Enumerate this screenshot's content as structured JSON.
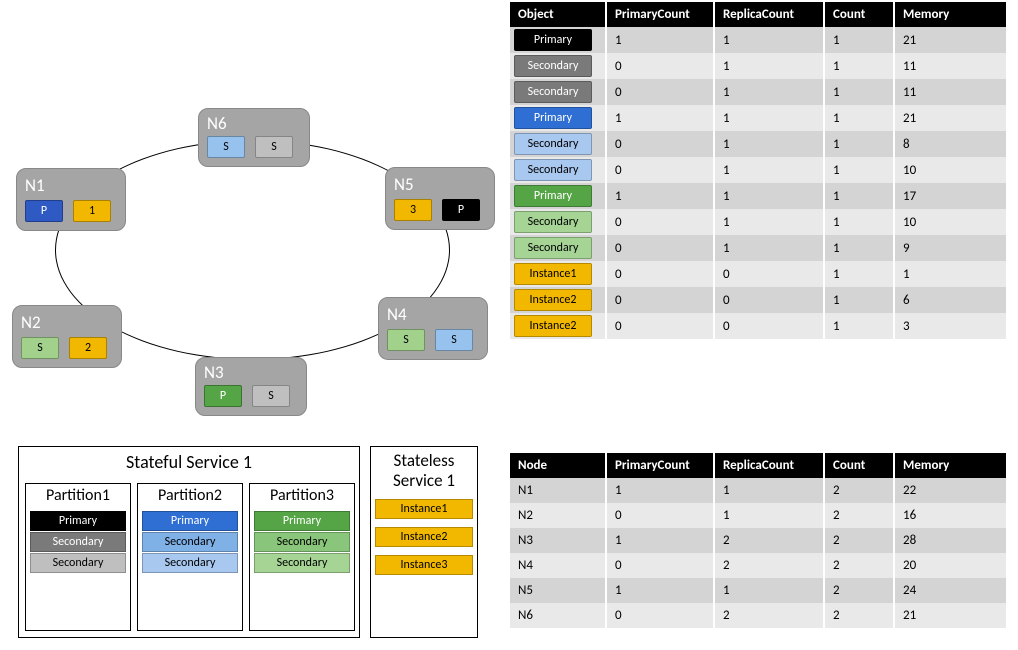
{
  "ring": {
    "nodes": {
      "N1": {
        "label": "N1",
        "chips": [
          {
            "txt": "P",
            "cls": "blue-d"
          },
          {
            "txt": "1",
            "cls": "orange"
          }
        ]
      },
      "N2": {
        "label": "N2",
        "chips": [
          {
            "txt": "S",
            "cls": "green-l"
          },
          {
            "txt": "2",
            "cls": "orange"
          }
        ]
      },
      "N3": {
        "label": "N3",
        "chips": [
          {
            "txt": "P",
            "cls": "green-d"
          },
          {
            "txt": "S",
            "cls": "gray-l"
          }
        ]
      },
      "N4": {
        "label": "N4",
        "chips": [
          {
            "txt": "S",
            "cls": "green-l"
          },
          {
            "txt": "S",
            "cls": "blue-l"
          }
        ]
      },
      "N5": {
        "label": "N5",
        "chips": [
          {
            "txt": "3",
            "cls": "orange"
          },
          {
            "txt": "P",
            "cls": "black"
          }
        ]
      },
      "N6": {
        "label": "N6",
        "chips": [
          {
            "txt": "S",
            "cls": "blue-l"
          },
          {
            "txt": "S",
            "cls": "gray-l"
          }
        ]
      }
    }
  },
  "table1": {
    "headers": [
      "Object",
      "PrimaryCount",
      "ReplicaCount",
      "Count",
      "Memory"
    ],
    "rows": [
      {
        "obj": {
          "txt": "Primary",
          "cls": "black"
        },
        "pc": "1",
        "rc": "1",
        "c": "1",
        "m": "21"
      },
      {
        "obj": {
          "txt": "Secondary",
          "cls": "gray-d"
        },
        "pc": "0",
        "rc": "1",
        "c": "1",
        "m": "11"
      },
      {
        "obj": {
          "txt": "Secondary",
          "cls": "gray-d"
        },
        "pc": "0",
        "rc": "1",
        "c": "1",
        "m": "11"
      },
      {
        "obj": {
          "txt": "Primary",
          "cls": "blue-d"
        },
        "pc": "1",
        "rc": "1",
        "c": "1",
        "m": "21"
      },
      {
        "obj": {
          "txt": "Secondary",
          "cls": "blue-l"
        },
        "pc": "0",
        "rc": "1",
        "c": "1",
        "m": "8"
      },
      {
        "obj": {
          "txt": "Secondary",
          "cls": "blue-l"
        },
        "pc": "0",
        "rc": "1",
        "c": "1",
        "m": "10"
      },
      {
        "obj": {
          "txt": "Primary",
          "cls": "green-d"
        },
        "pc": "1",
        "rc": "1",
        "c": "1",
        "m": "17"
      },
      {
        "obj": {
          "txt": "Secondary",
          "cls": "green-l"
        },
        "pc": "0",
        "rc": "1",
        "c": "1",
        "m": "10"
      },
      {
        "obj": {
          "txt": "Secondary",
          "cls": "green-l"
        },
        "pc": "0",
        "rc": "1",
        "c": "1",
        "m": "9"
      },
      {
        "obj": {
          "txt": "Instance1",
          "cls": "orange"
        },
        "pc": "0",
        "rc": "0",
        "c": "1",
        "m": "1"
      },
      {
        "obj": {
          "txt": "Instance2",
          "cls": "orange"
        },
        "pc": "0",
        "rc": "0",
        "c": "1",
        "m": "6"
      },
      {
        "obj": {
          "txt": "Instance2",
          "cls": "orange"
        },
        "pc": "0",
        "rc": "0",
        "c": "1",
        "m": "3"
      }
    ]
  },
  "table2": {
    "headers": [
      "Node",
      "PrimaryCount",
      "ReplicaCount",
      "Count",
      "Memory"
    ],
    "rows": [
      {
        "n": "N1",
        "pc": "1",
        "rc": "1",
        "c": "2",
        "m": "22"
      },
      {
        "n": "N2",
        "pc": "0",
        "rc": "1",
        "c": "2",
        "m": "16"
      },
      {
        "n": "N3",
        "pc": "1",
        "rc": "2",
        "c": "2",
        "m": "28"
      },
      {
        "n": "N4",
        "pc": "0",
        "rc": "2",
        "c": "2",
        "m": "20"
      },
      {
        "n": "N5",
        "pc": "1",
        "rc": "1",
        "c": "2",
        "m": "24"
      },
      {
        "n": "N6",
        "pc": "0",
        "rc": "2",
        "c": "2",
        "m": "21"
      }
    ]
  },
  "legend": {
    "stateful": {
      "title": "Stateful Service 1",
      "partitions": [
        {
          "title": "Partition1",
          "bars": [
            {
              "txt": "Primary",
              "cls": "black"
            },
            {
              "txt": "Secondary",
              "cls": "gray-d"
            },
            {
              "txt": "Secondary",
              "cls": "gray-l"
            }
          ]
        },
        {
          "title": "Partition2",
          "bars": [
            {
              "txt": "Primary",
              "cls": "blue-d"
            },
            {
              "txt": "Secondary",
              "cls": "blue-m"
            },
            {
              "txt": "Secondary",
              "cls": "blue-l"
            }
          ]
        },
        {
          "title": "Partition3",
          "bars": [
            {
              "txt": "Primary",
              "cls": "green-d"
            },
            {
              "txt": "Secondary",
              "cls": "green-m"
            },
            {
              "txt": "Secondary",
              "cls": "green-l"
            }
          ]
        }
      ]
    },
    "stateless": {
      "title": "Stateless Service 1",
      "bars": [
        {
          "txt": "Instance1",
          "cls": "orange"
        },
        {
          "txt": "Instance2",
          "cls": "orange"
        },
        {
          "txt": "Instance3",
          "cls": "orange"
        }
      ]
    }
  },
  "chart_data": [
    {
      "type": "table",
      "title": "Object metrics",
      "columns": [
        "Object",
        "PrimaryCount",
        "ReplicaCount",
        "Count",
        "Memory"
      ],
      "rows": [
        [
          "Primary",
          1,
          1,
          1,
          21
        ],
        [
          "Secondary",
          0,
          1,
          1,
          11
        ],
        [
          "Secondary",
          0,
          1,
          1,
          11
        ],
        [
          "Primary",
          1,
          1,
          1,
          21
        ],
        [
          "Secondary",
          0,
          1,
          1,
          8
        ],
        [
          "Secondary",
          0,
          1,
          1,
          10
        ],
        [
          "Primary",
          1,
          1,
          1,
          17
        ],
        [
          "Secondary",
          0,
          1,
          1,
          10
        ],
        [
          "Secondary",
          0,
          1,
          1,
          9
        ],
        [
          "Instance1",
          0,
          0,
          1,
          1
        ],
        [
          "Instance2",
          0,
          0,
          1,
          6
        ],
        [
          "Instance2",
          0,
          0,
          1,
          3
        ]
      ]
    },
    {
      "type": "table",
      "title": "Node metrics",
      "columns": [
        "Node",
        "PrimaryCount",
        "ReplicaCount",
        "Count",
        "Memory"
      ],
      "rows": [
        [
          "N1",
          1,
          1,
          2,
          22
        ],
        [
          "N2",
          0,
          1,
          2,
          16
        ],
        [
          "N3",
          1,
          2,
          2,
          28
        ],
        [
          "N4",
          0,
          2,
          2,
          20
        ],
        [
          "N5",
          1,
          1,
          2,
          24
        ],
        [
          "N6",
          0,
          2,
          2,
          21
        ]
      ]
    }
  ]
}
